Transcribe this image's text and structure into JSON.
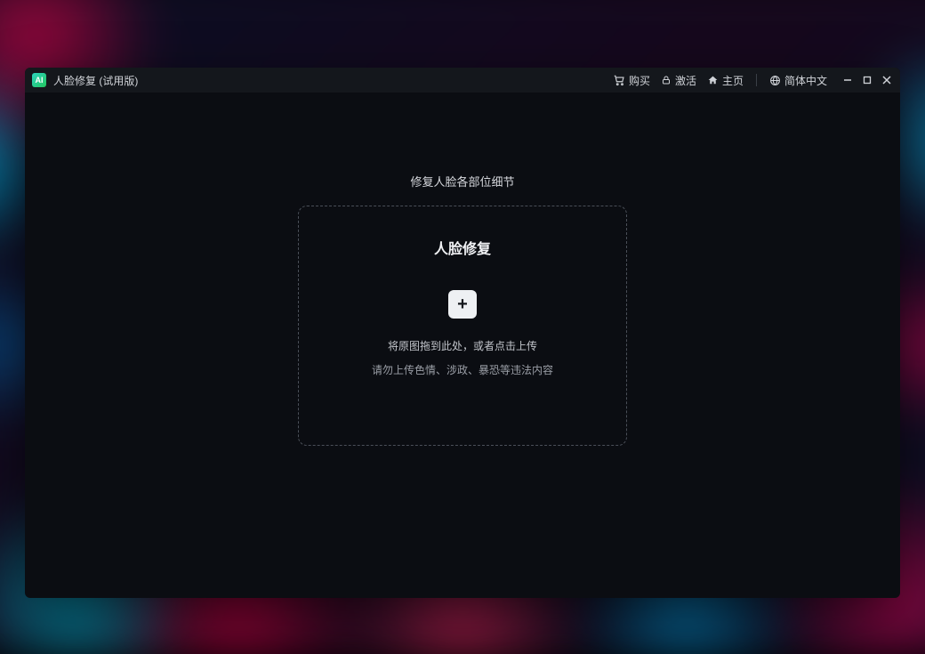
{
  "titlebar": {
    "logo_text": "AI",
    "title": "人脸修复 (试用版)",
    "buy_label": "购买",
    "activate_label": "激活",
    "home_label": "主页",
    "language_label": "简体中文"
  },
  "content": {
    "section_title": "修复人脸各部位细节",
    "dropzone": {
      "title": "人脸修复",
      "plus": "+",
      "hint": "将原图拖到此处，或者点击上传",
      "warning": "请勿上传色情、涉政、暴恐等违法内容"
    }
  }
}
